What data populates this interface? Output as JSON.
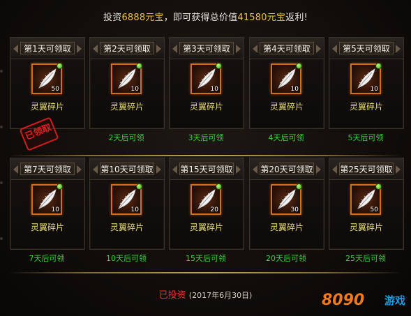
{
  "banner": {
    "prefix": "投资",
    "amount1": "6888元宝",
    "middle": "，即可获得总价值",
    "amount2": "41580元宝",
    "suffix": "返利!"
  },
  "rewards": [
    {
      "title": "第1天可领取",
      "item": "灵翼碎片",
      "qty": "50",
      "status": "已领取"
    },
    {
      "title": "第2天可领取",
      "item": "灵翼碎片",
      "qty": "10",
      "status": "2天后可领"
    },
    {
      "title": "第3天可领取",
      "item": "灵翼碎片",
      "qty": "10",
      "status": "3天后可领"
    },
    {
      "title": "第4天可领取",
      "item": "灵翼碎片",
      "qty": "10",
      "status": "4天后可领"
    },
    {
      "title": "第5天可领取",
      "item": "灵翼碎片",
      "qty": "10",
      "status": "5天后可领"
    },
    {
      "title": "第7天可领取",
      "item": "灵翼碎片",
      "qty": "10",
      "status": "7天后可领"
    },
    {
      "title": "第10天可领取",
      "item": "灵翼碎片",
      "qty": "10",
      "status": "10天后可领"
    },
    {
      "title": "第15天可领取",
      "item": "灵翼碎片",
      "qty": "20",
      "status": "15天后可领"
    },
    {
      "title": "第20天可领取",
      "item": "灵翼碎片",
      "qty": "30",
      "status": "20天后可领"
    },
    {
      "title": "第25天可领取",
      "item": "灵翼碎片",
      "qty": "50",
      "status": "25天后可领"
    }
  ],
  "footer": {
    "status": "已投资",
    "date": "(2017年6月30日)"
  },
  "logo": {
    "num": "8090",
    "text": "游戏"
  },
  "colors": {
    "gold": "#f2c33c",
    "green": "#3fd13f",
    "red": "#ff2b2b",
    "item": "#e9de7a"
  },
  "icons": {
    "item_icon": "feather-icon",
    "claimed_stamp": "claimed-stamp"
  }
}
